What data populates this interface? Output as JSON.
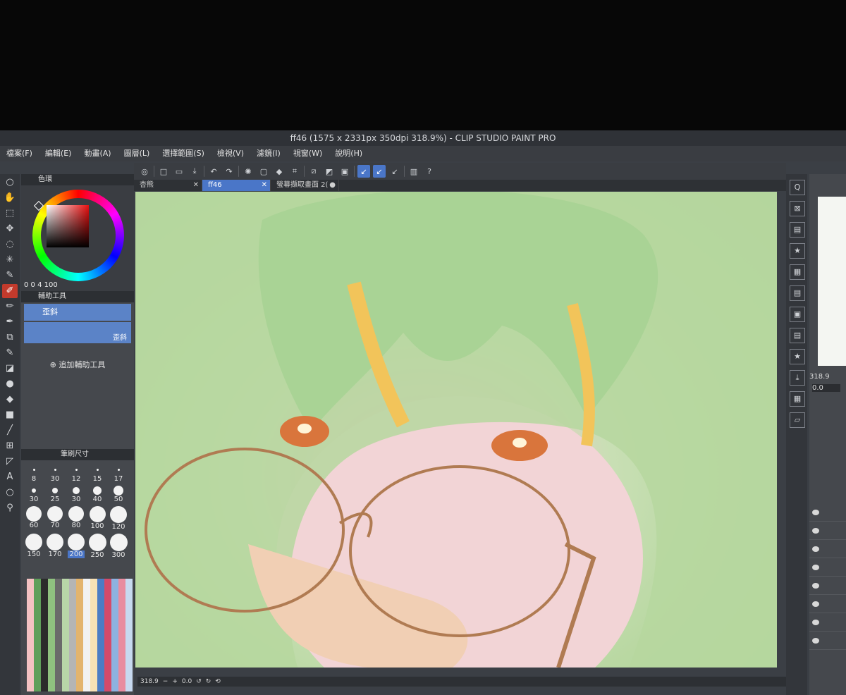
{
  "window": {
    "title": "ff46 (1575 x 2331px 350dpi 318.9%) - CLIP STUDIO PAINT PRO"
  },
  "menu": [
    "檔案(F)",
    "編輯(E)",
    "動畫(A)",
    "圖層(L)",
    "選擇範圍(S)",
    "檢視(V)",
    "濾鏡(I)",
    "視窗(W)",
    "說明(H)"
  ],
  "color_panel": {
    "tab": "色環",
    "hsv": "0  0  4 100"
  },
  "subtool_panel": {
    "tab": "輔助工具",
    "items": [
      {
        "label": "歪斜"
      },
      {
        "label": "",
        "sublabel": "歪斜"
      }
    ],
    "add_label": "追加輔助工具"
  },
  "brush_size": {
    "tab": "筆刷尺寸",
    "sizes": [
      "8",
      "30",
      "12",
      "15",
      "17",
      "30",
      "25",
      "30",
      "40",
      "50",
      "60",
      "70",
      "80",
      "100",
      "120",
      "150",
      "170",
      "200",
      "250",
      "300"
    ],
    "selected": "200"
  },
  "canvas_tabs": [
    {
      "label": "杏熊"
    },
    {
      "label": "ff46",
      "active": true
    },
    {
      "label": "螢幕擷取畫面 2("
    }
  ],
  "status": {
    "zoom": "318.9",
    "angle": "0.0"
  },
  "navigator": {
    "zoom": "318.9",
    "angle": "0.0"
  }
}
